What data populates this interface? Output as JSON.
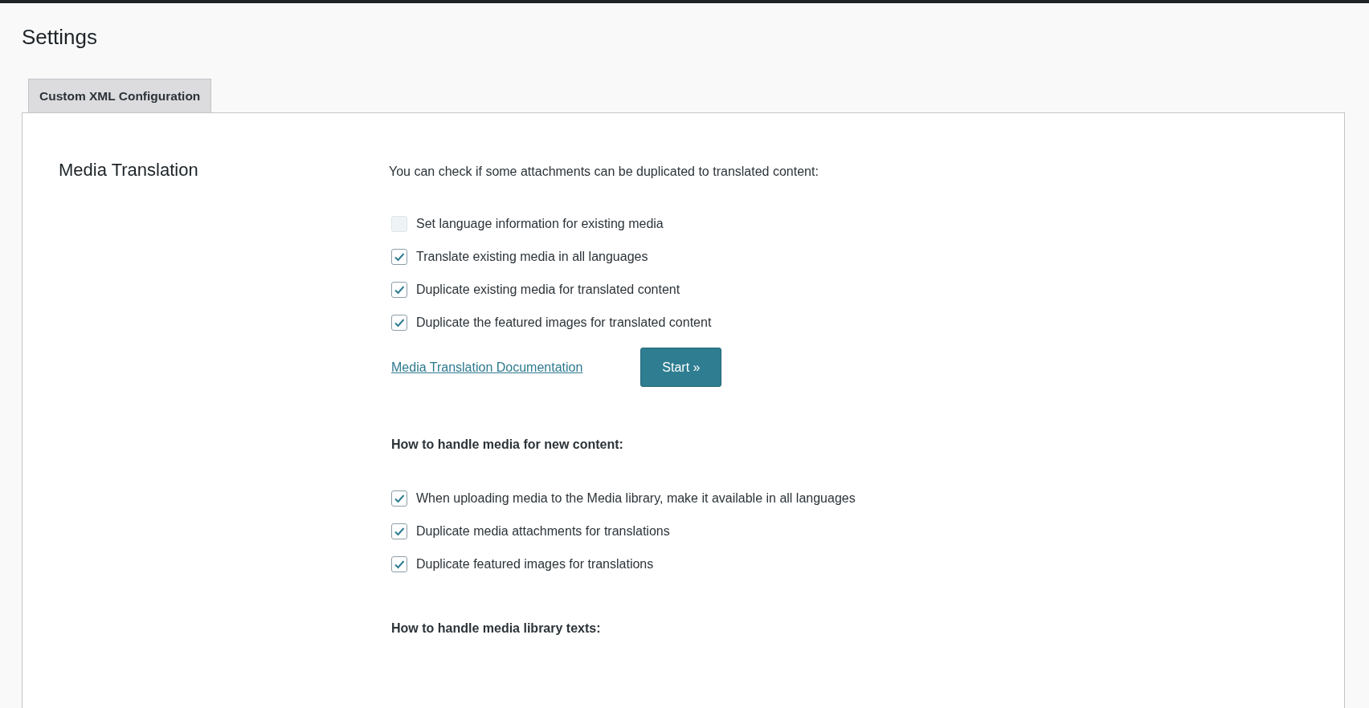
{
  "page_title": "Settings",
  "tabs": [
    {
      "label": "Custom XML Configuration",
      "selected": true
    }
  ],
  "section": {
    "title": "Media Translation",
    "intro": "You can check if some attachments can be duplicated to translated content:",
    "existing_media_options": [
      {
        "label": "Set language information for existing media",
        "checked": false,
        "disabled": true
      },
      {
        "label": "Translate existing media in all languages",
        "checked": true,
        "disabled": false
      },
      {
        "label": "Duplicate existing media for translated content",
        "checked": true,
        "disabled": false
      },
      {
        "label": "Duplicate the featured images for translated content",
        "checked": true,
        "disabled": false
      }
    ],
    "documentation_link": "Media Translation Documentation",
    "start_button": "Start »",
    "new_content_heading": "How to handle media for new content:",
    "new_content_options": [
      {
        "label": "When uploading media to the Media library, make it available in all languages",
        "checked": true
      },
      {
        "label": "Duplicate media attachments for translations",
        "checked": true
      },
      {
        "label": "Duplicate featured images for translations",
        "checked": true
      }
    ],
    "library_texts_heading": "How to handle media library texts:"
  }
}
